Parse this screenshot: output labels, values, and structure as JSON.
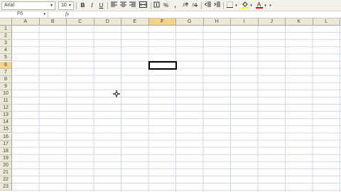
{
  "toolbar": {
    "font_name": "Arial",
    "font_size": "10",
    "bold": "B",
    "italic": "I",
    "underline": "U",
    "percent": "%",
    "comma": ","
  },
  "formula_bar": {
    "name_box": "F6",
    "fx": "fx"
  },
  "columns": [
    "A",
    "B",
    "C",
    "D",
    "E",
    "F",
    "G",
    "H",
    "I",
    "J",
    "K",
    "L"
  ],
  "rows": [
    "1",
    "2",
    "3",
    "4",
    "5",
    "6",
    "7",
    "8",
    "9",
    "10",
    "11",
    "12",
    "13",
    "14",
    "15",
    "16",
    "17",
    "18",
    "19",
    "20",
    "21",
    "22",
    "23"
  ],
  "active_cell": {
    "column": "F",
    "row": "6"
  },
  "colors": {
    "selection_header": "#f8d28a",
    "header_bg": "#ece9d8",
    "gridline": "#d0d7e5"
  }
}
